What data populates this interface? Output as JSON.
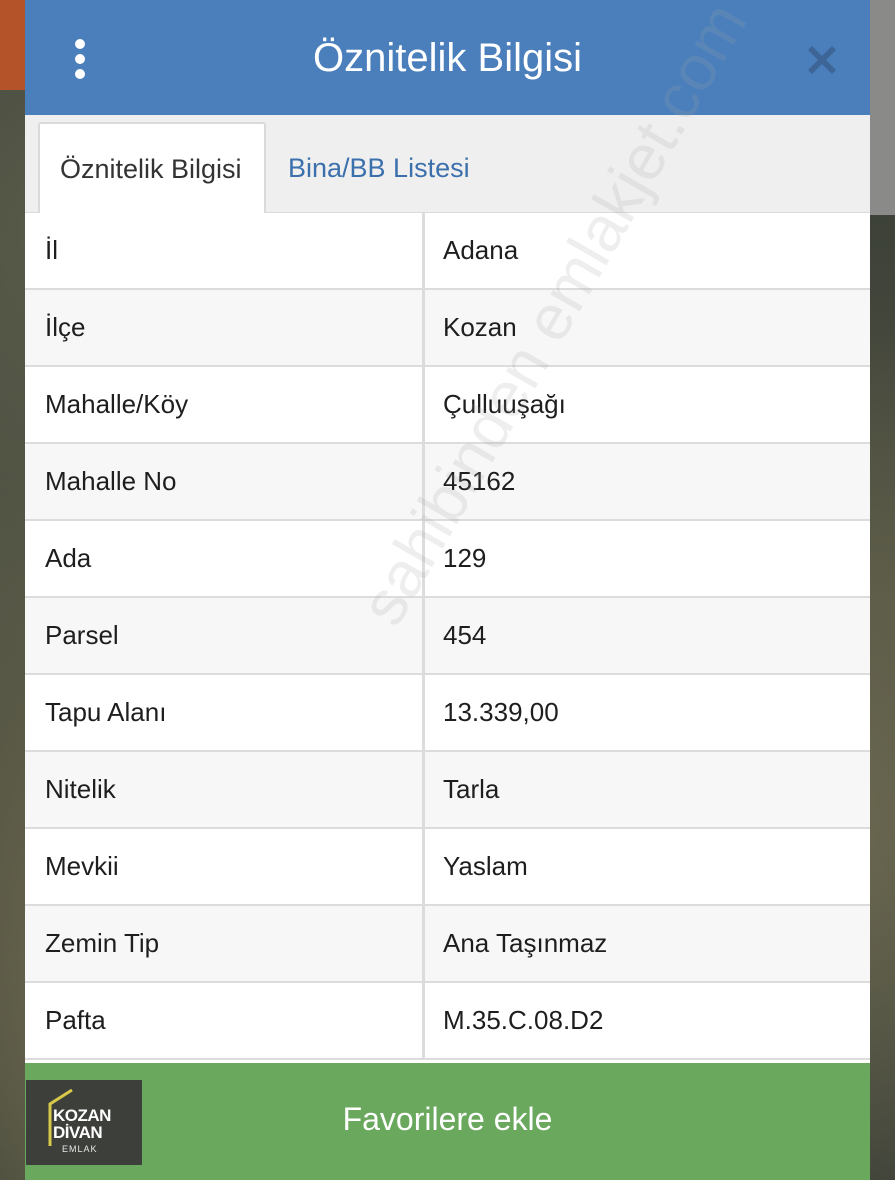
{
  "header": {
    "title": "Öznitelik Bilgisi",
    "menu_icon": "kebab-menu-icon",
    "close_icon": "close-icon"
  },
  "tabs": [
    {
      "label": "Öznitelik Bilgisi",
      "active": true
    },
    {
      "label": "Bina/BB Listesi",
      "active": false
    }
  ],
  "attributes": [
    {
      "label": "İl",
      "value": "Adana"
    },
    {
      "label": "İlçe",
      "value": "Kozan"
    },
    {
      "label": "Mahalle/Köy",
      "value": "Çulluuşağı"
    },
    {
      "label": "Mahalle No",
      "value": "45162"
    },
    {
      "label": "Ada",
      "value": "129"
    },
    {
      "label": "Parsel",
      "value": "454"
    },
    {
      "label": "Tapu Alanı",
      "value": "13.339,00"
    },
    {
      "label": "Nitelik",
      "value": "Tarla"
    },
    {
      "label": "Mevkii",
      "value": "Yaslam"
    },
    {
      "label": "Zemin Tip",
      "value": "Ana Taşınmaz"
    },
    {
      "label": "Pafta",
      "value": "M.35.C.08.D2"
    }
  ],
  "footer": {
    "favorite_label": "Favorilere ekle"
  },
  "logo": {
    "line1": "KOZAN",
    "line2": "DİVAN",
    "line3": "EMLAK"
  },
  "watermark": "sahibinden emlakjet.com",
  "colors": {
    "header_bg": "#4a7fbc",
    "tab_active_text": "#333333",
    "tab_inactive_text": "#3b70ad",
    "footer_bg": "#6aa85e"
  }
}
